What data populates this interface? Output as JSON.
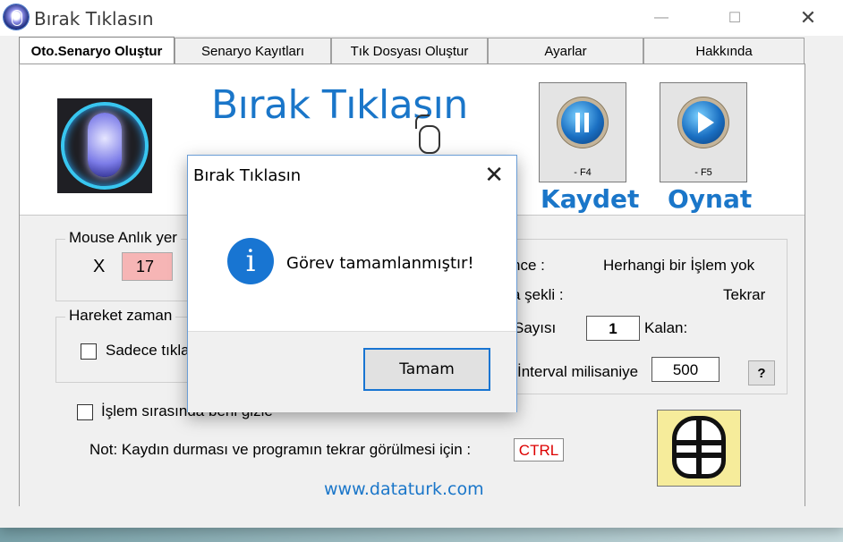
{
  "window": {
    "title": "Bırak Tıklasın",
    "controls": {
      "minimize": "—",
      "maximize": "☐",
      "close": "✕"
    }
  },
  "tabs": [
    {
      "label": "Oto.Senaryo Oluştur",
      "active": true
    },
    {
      "label": "Senaryo Kayıtları"
    },
    {
      "label": "Tık Dosyası Oluştur"
    },
    {
      "label": "Ayarlar"
    },
    {
      "label": "Hakkında"
    }
  ],
  "header": {
    "app_title": "Bırak Tıklasın",
    "record_button": {
      "shortcut": "- F4",
      "label": "Kaydet"
    },
    "play_button": {
      "shortcut": "- F5",
      "label": "Oynat"
    }
  },
  "mouse_position": {
    "group_title": "Mouse Anlık yer",
    "x_label": "X",
    "x_value": "17"
  },
  "movement": {
    "group_title": "Hareket zaman",
    "only_clicks_label": "Sadece tıkla"
  },
  "status": {
    "state_label": "nce :",
    "state_value": "Herhangi bir İşlem yok",
    "mode_label": "a şekli :",
    "mode_value": "Tekrar",
    "count_label": "Sayısı",
    "count_value": "1",
    "remaining_label": "Kalan:",
    "interval_label": "İnterval milisaniye",
    "interval_value": "500",
    "help_label": "?"
  },
  "hide_option_label": "İşlem sırasında beni gizle",
  "note": {
    "text": "Not: Kaydın durması ve programın tekrar görülmesi için :",
    "key": "CTRL"
  },
  "website": "www.dataturk.com",
  "dialog": {
    "title": "Bırak Tıklasın",
    "close": "✕",
    "icon": "i",
    "message": "Görev tamamlanmıştır!",
    "ok_label": "Tamam"
  },
  "colors": {
    "accent_blue": "#1a76c9",
    "info_blue": "#1875d2",
    "x_value_bg": "#f6b5b5",
    "ctrl_red": "#dd0000"
  }
}
